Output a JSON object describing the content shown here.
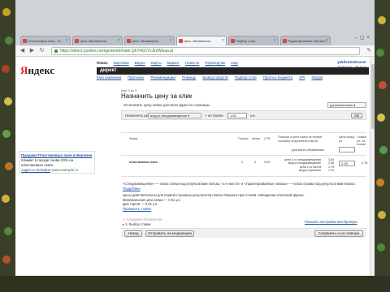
{
  "browser": {
    "tabs": [
      {
        "label": "пластиковые окна - Я..."
      },
      {
        "label": "Цель объявления"
      },
      {
        "label": "Цель объявления"
      },
      {
        "label": "Цель объявления"
      },
      {
        "label": "Подбор слов"
      },
      {
        "label": "Редактирование инсталл..."
      }
    ],
    "url": "https://direct.yandex.ru/registered/main.QhT4G1YvJkzWlxaa.pl"
  },
  "site": {
    "logo_ya": "Я",
    "logo_rest": "ндекс",
    "user_name": "yaklientenkruser",
    "user_links": "Помощь · Выход",
    "top_menu": [
      "Поиск",
      "Картинки",
      "Видео",
      "Карты",
      "Маркет",
      "Новости",
      "Переводчик",
      "ещё"
    ],
    "section": "директ",
    "sub_menu": [
      "Мои кампании",
      "Прогнозы",
      "Рекомендации",
      "Помощь",
      "Вывод средств",
      "Подбор слов",
      "Прогноз бюджета",
      "API",
      "Форум"
    ]
  },
  "form": {
    "step": "Шаг 3 из 3",
    "title": "Назначить цену за клик",
    "set_price_label": "Установить цену клика для всех фраз из страницы",
    "dropdown_right": "дополнительно",
    "band_label": "Назначить цену",
    "band_select": "вход в спецразмещение",
    "band_plus": "+ не более",
    "band_value": "1,50",
    "band_unit": "у.е.",
    "ok": "ОК"
  },
  "ad": {
    "title": "Продажа Пластиковых окон в Берлине",
    "text": "Климат в городе снова 20% на пластиковые окна!",
    "link": "Адрес и телефон",
    "domain": "www.example.ru"
  },
  "table": {
    "headers": [
      "Фраза",
      "Показы",
      "Клики",
      "CTR",
      "Позиция и цена клика на первой странице результатов поиска",
      "Цена клика, у.е.",
      "Ставка, у.е. на поиске"
    ],
    "all_price_label": "Для всего объявления:",
    "row": {
      "phrase": "пластиковые окна",
      "shows": "0",
      "clicks": "0",
      "ctr": "0.00",
      "positions": [
        "цена 1-го спецразмещения",
        "вход в спецразмещение",
        "цена 1-го места",
        "вход в гарантию"
      ],
      "prices": [
        "3.84",
        "2.85",
        "1.75",
        "1.10"
      ],
      "price": "2.28",
      "bid": "1.75"
    }
  },
  "notes": {
    "line1": "«Спецразмещение» — показ слева над результатами поиска; «1-е место» и «Гарантированные показы» — показ справа под результатами поиска.",
    "help": "Подробнее",
    "line2": "Цены действительны для первой страницы результатов поиска Яндекса при точном совпадении ключевой фразы.",
    "min_price": "Минимальная цена клика — 0.01 у.е.",
    "price_note": "Для торгов — 0.01 у.е.",
    "check_link": "Проверить ставки",
    "create_label": "Создание объявления",
    "view_label": "2. Выбор ставки",
    "settings_link": "Показать настройки автоброкера"
  },
  "footer": {
    "back": "Назад",
    "send": "Отправить на модерацию",
    "save": "Сохранить и на главную"
  }
}
